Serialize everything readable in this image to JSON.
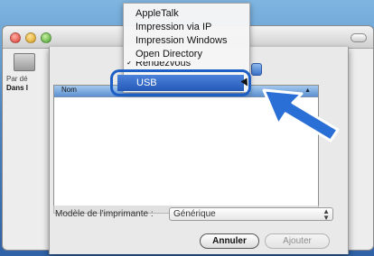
{
  "background_window": {
    "par_label": "Par dé",
    "dans_label": "Dans l"
  },
  "menu": {
    "items": [
      "AppleTalk",
      "Impression via IP",
      "Impression Windows",
      "Open Directory",
      "Rendezvous"
    ],
    "selected": "USB"
  },
  "printer_list": {
    "column_header": "Nom"
  },
  "model": {
    "label": "Modèle de l'imprimante :",
    "value": "Générique"
  },
  "buttons": {
    "cancel": "Annuler",
    "add": "Ajouter"
  },
  "colors": {
    "highlight": "#1d5fc4",
    "arrow": "#2a6fd6"
  }
}
